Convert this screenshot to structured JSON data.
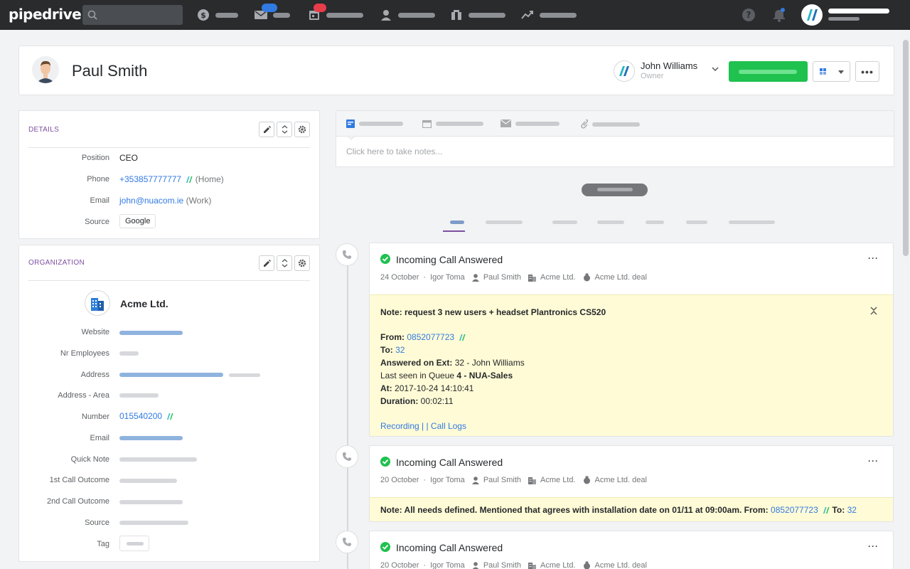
{
  "app": {
    "logo": "pipedrive"
  },
  "topbar": {
    "icons": [
      "search-icon",
      "deals-icon",
      "mail-icon",
      "activities-icon",
      "contacts-icon",
      "products-icon",
      "insights-icon",
      "help-icon",
      "notifications-icon"
    ]
  },
  "person": {
    "name": "Paul Smith",
    "owner_name": "John Williams",
    "owner_role": "Owner"
  },
  "details": {
    "title": "DETAILS",
    "position_label": "Position",
    "position_value": "CEO",
    "phone_label": "Phone",
    "phone_value": "+353857777777",
    "phone_type": "(Home)",
    "email_label": "Email",
    "email_value": "john@nuacom.ie",
    "email_type": "(Work)",
    "source_label": "Source",
    "source_value": "Google"
  },
  "organization": {
    "title": "ORGANIZATION",
    "name": "Acme Ltd.",
    "labels": {
      "website": "Website",
      "employees": "Nr Employees",
      "address": "Address",
      "address_area": "Address - Area",
      "number": "Number",
      "email": "Email",
      "quick_note": "Quick Note",
      "call1": "1st Call Outcome",
      "call2": "2nd Call Outcome",
      "source": "Source",
      "tag": "Tag"
    },
    "number_value": "015540200"
  },
  "composer": {
    "placeholder": "Click here to take notes..."
  },
  "activities": [
    {
      "title": "Incoming Call Answered",
      "date": "24 October",
      "user": "Igor Toma",
      "person": "Paul Smith",
      "org": "Acme Ltd.",
      "deal": "Acme Ltd. deal",
      "note_title": "Note: request 3 new users + headset Plantronics CS520",
      "from_label": "From:",
      "from_value": "0852077723",
      "to_label": "To:",
      "to_value": "32",
      "answered_label": "Answered on Ext:",
      "answered_value": "32  -  John Williams",
      "queue_prefix": "Last seen in Queue",
      "queue_value": "4 - NUA-Sales",
      "at_label": "At:",
      "at_value": "2017-10-24 14:10:41",
      "duration_label": "Duration:",
      "duration_value": "00:02:11",
      "recording_link": "Recording | ",
      "calllogs_link": "| Call Logs"
    },
    {
      "title": "Incoming Call Answered",
      "date": "20 October",
      "user": "Igor Toma",
      "person": "Paul Smith",
      "org": "Acme Ltd.",
      "deal": "Acme Ltd. deal",
      "note_text": "Note: All needs defined. Mentioned that agrees with installation date on 01/11 at 09:00am. From:",
      "from_value": "0852077723",
      "to_label": "To:",
      "to_value": "32"
    },
    {
      "title": "Incoming Call Answered",
      "date": "20 October",
      "user": "Igor Toma",
      "person": "Paul Smith",
      "org": "Acme Ltd.",
      "deal": "Acme Ltd. deal"
    }
  ],
  "colors": {
    "topbar": "#292b2d",
    "accent_purple": "#7e4fa1",
    "link_blue": "#317ae2",
    "success_green": "#1fc14f",
    "note_yellow": "#fffbd6"
  }
}
